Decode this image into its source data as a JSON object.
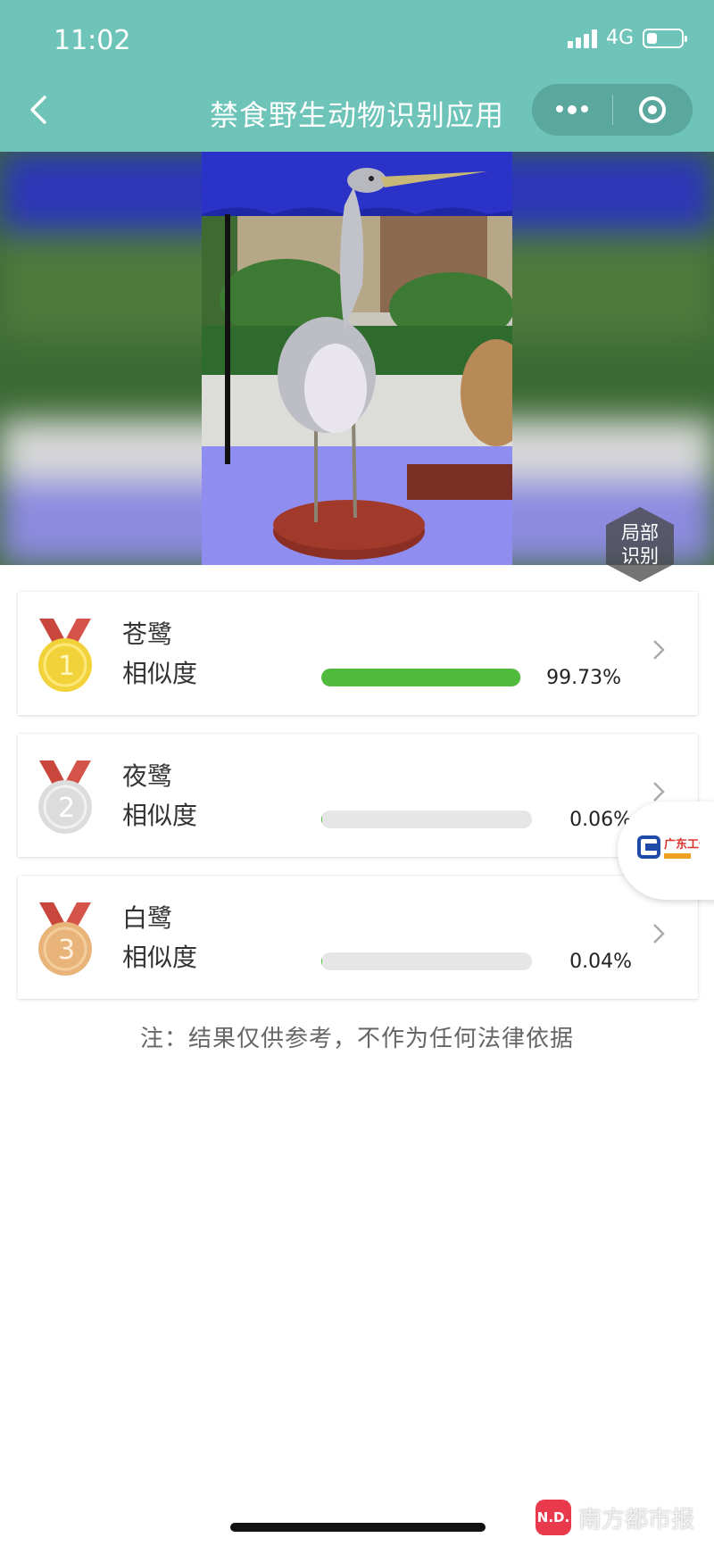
{
  "status_bar": {
    "time": "11:02",
    "network": "4G",
    "battery_level": 0.3
  },
  "nav": {
    "title": "禁食野生动物识别应用"
  },
  "image_overlay": {
    "partial_recognition_label": "局部识别"
  },
  "results": [
    {
      "rank": "1",
      "name": "苍鹭",
      "similarity_label": "相似度",
      "percent": "99.73%",
      "level": 0.9973,
      "medal_color": "#f2d23a",
      "ribbon_color": "#c9463d"
    },
    {
      "rank": "2",
      "name": "夜鹭",
      "similarity_label": "相似度",
      "percent": "0.06%",
      "level": 0.0006,
      "medal_color": "#d9d9d9",
      "ribbon_color": "#c9463d"
    },
    {
      "rank": "3",
      "name": "白鹭",
      "similarity_label": "相似度",
      "percent": "0.04%",
      "level": 0.0004,
      "medal_color": "#e8b47a",
      "ribbon_color": "#c9463d"
    }
  ],
  "note": "注：结果仅供参考，不作为任何法律依据",
  "floating_logo": {
    "label": "广东工信"
  },
  "watermark": {
    "text": "南方都市报",
    "logo": "N.D."
  },
  "colors": {
    "header": "#6ec4b9",
    "progress": "#4fba3b"
  }
}
